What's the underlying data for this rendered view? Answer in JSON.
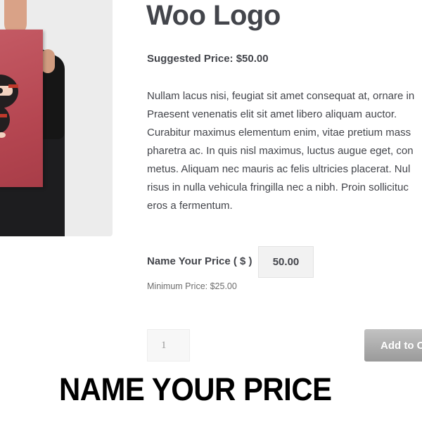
{
  "product": {
    "title": "Woo Logo",
    "suggested_price": "Suggested Price: $50.00",
    "description_lines": [
      "Nullam lacus nisi, feugiat sit amet consequat at, ornare in",
      "Praesent venenatis elit sit amet libero aliquam auctor.",
      "Curabitur maximus elementum enim, vitae pretium mass",
      "pharetra ac. In quis nisl maximus, luctus augue eget, con",
      "metus. Aliquam nec mauris ac felis ultricies placerat. Nul",
      "risus in nulla vehicula fringilla nec a nibh. Proin sollicituc",
      "eros a fermentum."
    ],
    "image_icon": "ninja-poster-illustration"
  },
  "name_your_price": {
    "label": "Name Your Price ( $ )",
    "value": "50.00",
    "minimum": "Minimum Price: $25.00"
  },
  "cart": {
    "quantity": "1",
    "add_to_cart_label": "Add to C"
  },
  "banner": "NAME YOUR PRICE",
  "colors": {
    "text": "#43454b",
    "poster": "#b54651",
    "button": "#a9a9a9"
  }
}
